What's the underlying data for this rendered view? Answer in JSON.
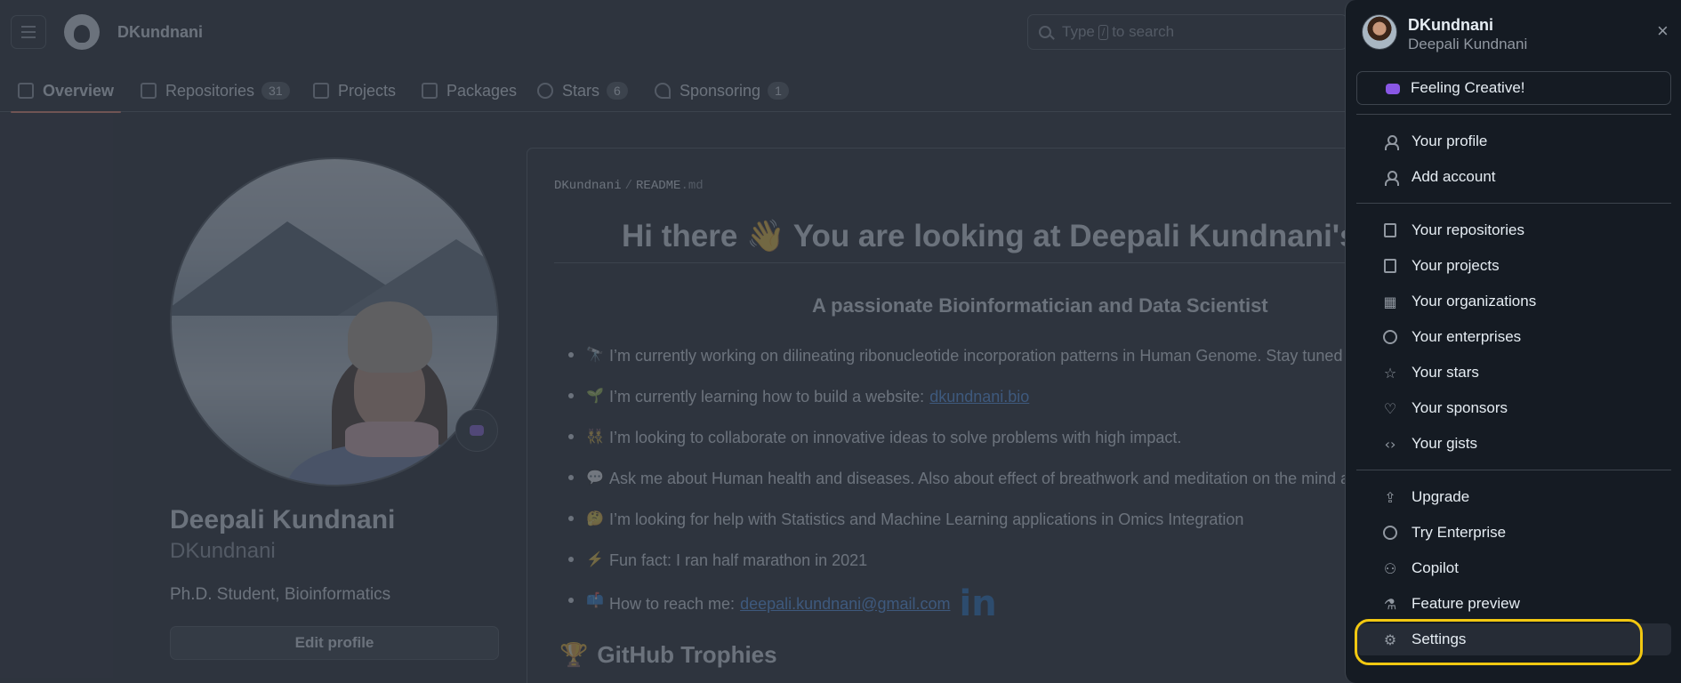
{
  "header": {
    "menu_label": "Open global navigation menu",
    "username": "DKundnani",
    "search_placeholder_pre": "Type",
    "search_key": "/",
    "search_placeholder_post": "to search"
  },
  "tabs": [
    {
      "label": "Overview",
      "count": null,
      "icon": "book-icon"
    },
    {
      "label": "Repositories",
      "count": "31",
      "icon": "repo-icon"
    },
    {
      "label": "Projects",
      "count": null,
      "icon": "table-icon"
    },
    {
      "label": "Packages",
      "count": null,
      "icon": "package-icon"
    },
    {
      "label": "Stars",
      "count": "6",
      "icon": "star-icon"
    },
    {
      "label": "Sponsoring",
      "count": "1",
      "icon": "heart-icon"
    }
  ],
  "profile": {
    "full_name": "Deepali Kundnani",
    "login": "DKundnani",
    "bio": "Ph.D. Student, Bioinformatics",
    "edit_label": "Edit profile"
  },
  "readme": {
    "path_user": "DKundnani",
    "path_file": "README",
    "path_ext": ".md",
    "heading": "Hi there 👋 You are looking at Deepali Kundnani's Profile",
    "subheading": "A passionate Bioinformatician and Data Scientist",
    "items": [
      {
        "emoji": "🔭",
        "text": "I’m currently working on dilineating ribonucleotide incorporation patterns in Human Genome. Stay tuned for more!",
        "link": ""
      },
      {
        "emoji": "🌱",
        "text": "I’m currently learning how to build a website:",
        "link": "dkundnani.bio"
      },
      {
        "emoji": "👯",
        "text": "I’m looking to collaborate on innovative ideas to solve problems with high impact.",
        "link": ""
      },
      {
        "emoji": "💬",
        "text": "Ask me about Human health and diseases. Also about effect of breathwork and meditation on the mind and body.",
        "link": ""
      },
      {
        "emoji": "🤔",
        "text": "I’m looking for help with Statistics and Machine Learning applications in Omics Integration",
        "link": ""
      },
      {
        "emoji": "⚡",
        "text": "Fun fact: I ran half marathon in 2021",
        "link": ""
      },
      {
        "emoji": "📫",
        "text": "How to reach me:",
        "link": "deepali.kundnani@gmail.com"
      }
    ],
    "linkedin_glyph": "in",
    "trophies_heading": "GitHub Trophies",
    "trophy_icon": "🏆"
  },
  "drawer": {
    "login": "DKundnani",
    "name": "Deepali Kundnani",
    "close_glyph": "×",
    "status": "Feeling Creative!",
    "items": [
      {
        "label": "Your profile",
        "icon": "person-icon",
        "glyph": ""
      },
      {
        "label": "Add account",
        "icon": "person-add-icon",
        "glyph": ""
      },
      {
        "label": "Your repositories",
        "icon": "repo-icon",
        "glyph": ""
      },
      {
        "label": "Your projects",
        "icon": "table-icon",
        "glyph": ""
      },
      {
        "label": "Your organizations",
        "icon": "organization-icon",
        "glyph": "▦"
      },
      {
        "label": "Your enterprises",
        "icon": "globe-icon",
        "glyph": ""
      },
      {
        "label": "Your stars",
        "icon": "star-icon",
        "glyph": "☆"
      },
      {
        "label": "Your sponsors",
        "icon": "heart-icon",
        "glyph": "♡"
      },
      {
        "label": "Your gists",
        "icon": "code-square-icon",
        "glyph": "‹›"
      },
      {
        "label": "Upgrade",
        "icon": "upload-icon",
        "glyph": "⇪"
      },
      {
        "label": "Try Enterprise",
        "icon": "globe-icon",
        "glyph": ""
      },
      {
        "label": "Copilot",
        "icon": "copilot-icon",
        "glyph": "⚇"
      },
      {
        "label": "Feature preview",
        "icon": "beaker-icon",
        "glyph": "⚗"
      },
      {
        "label": "Settings",
        "icon": "gear-icon",
        "glyph": "⚙"
      }
    ],
    "highlight_color": "#f2c811"
  },
  "colors": {
    "accent_tab": "#f78166",
    "link": "#4493f8",
    "status_emoji": "#8957e5"
  }
}
